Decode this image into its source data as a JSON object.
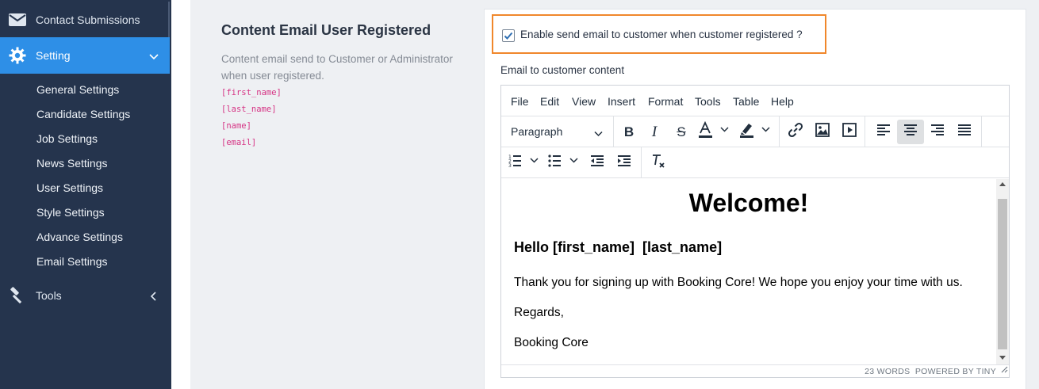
{
  "sidebar": {
    "contact": {
      "label": "Contact Submissions",
      "icon": "envelope-icon"
    },
    "setting": {
      "label": "Setting",
      "icon": "gear-icon"
    },
    "sub_items": [
      "General Settings",
      "Candidate Settings",
      "Job Settings",
      "News Settings",
      "User Settings",
      "Style Settings",
      "Advance Settings",
      "Email Settings"
    ],
    "tools": {
      "label": "Tools",
      "icon": "hammer-icon"
    }
  },
  "section": {
    "title": "Content Email User Registered",
    "description": "Content email send to Customer or Administrator when user registered.",
    "placeholders": [
      "[first_name]",
      "[last_name]",
      "[name]",
      "[email]"
    ]
  },
  "form": {
    "enable_checkbox": {
      "label": "Enable send email to customer when customer registered ?",
      "checked": true
    },
    "content_label": "Email to customer content"
  },
  "editor": {
    "menu": [
      "File",
      "Edit",
      "View",
      "Insert",
      "Format",
      "Tools",
      "Table",
      "Help"
    ],
    "block_format": "Paragraph",
    "content": {
      "heading": "Welcome!",
      "greeting": "Hello [first_name]  [last_name]",
      "paragraphs": [
        "Thank you for signing up with Booking Core! We hope you enjoy your time with us.",
        "Regards,",
        "Booking Core"
      ]
    },
    "status": {
      "word_count": "23 WORDS",
      "branding": "POWERED BY TINY"
    }
  },
  "colors": {
    "sidebar_bg": "#25344d",
    "active_item": "#2e8fe7",
    "highlight_border": "#f0872b",
    "placeholder_code": "#d63384"
  }
}
